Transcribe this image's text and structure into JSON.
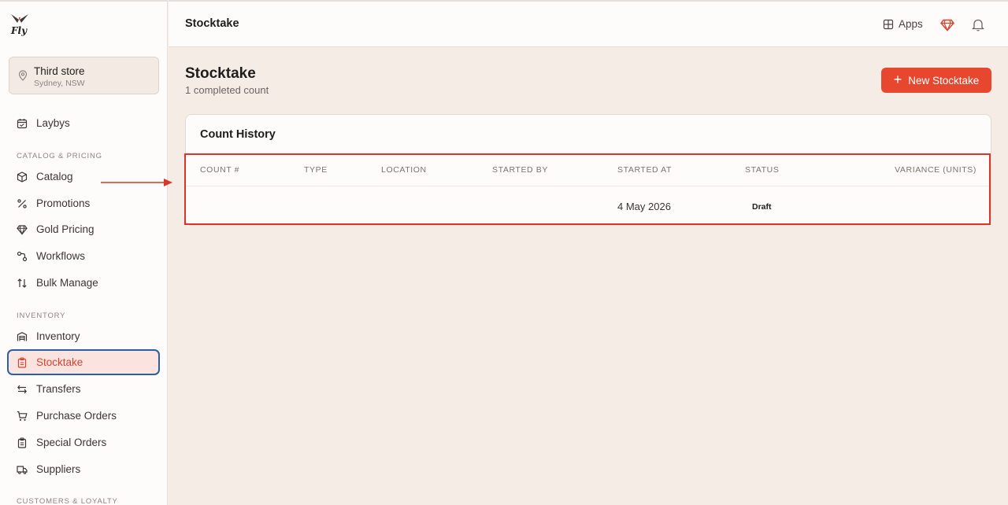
{
  "brand": {
    "logo_text": "Fly"
  },
  "store": {
    "name": "Third store",
    "location": "Sydney, NSW",
    "icon": "map-pin-icon"
  },
  "sidebar": {
    "items_top": [
      {
        "label": "Laybys",
        "icon": "calendar-icon"
      }
    ],
    "sections": [
      {
        "label": "CATALOG & PRICING",
        "items": [
          {
            "label": "Catalog",
            "icon": "box-icon"
          },
          {
            "label": "Promotions",
            "icon": "percent-icon"
          },
          {
            "label": "Gold Pricing",
            "icon": "gem-icon"
          },
          {
            "label": "Workflows",
            "icon": "workflow-icon"
          },
          {
            "label": "Bulk Manage",
            "icon": "arrows-up-down-icon"
          }
        ]
      },
      {
        "label": "INVENTORY",
        "items": [
          {
            "label": "Inventory",
            "icon": "warehouse-icon"
          },
          {
            "label": "Stocktake",
            "icon": "clipboard-icon",
            "active": true
          },
          {
            "label": "Transfers",
            "icon": "transfer-icon"
          },
          {
            "label": "Purchase Orders",
            "icon": "cart-icon"
          },
          {
            "label": "Special Orders",
            "icon": "clipboard-list-icon"
          },
          {
            "label": "Suppliers",
            "icon": "truck-icon"
          }
        ]
      },
      {
        "label": "CUSTOMERS & LOYALTY",
        "items": []
      }
    ]
  },
  "topbar": {
    "title": "Stocktake",
    "apps_label": "Apps"
  },
  "page": {
    "title": "Stocktake",
    "subtitle": "1 completed count",
    "new_button_label": "New Stocktake"
  },
  "history": {
    "title": "Count History",
    "columns": [
      "COUNT #",
      "TYPE",
      "LOCATION",
      "STARTED BY",
      "STARTED AT",
      "STATUS",
      "VARIANCE (UNITS)"
    ],
    "rows": [
      {
        "count": "",
        "type": "",
        "location": "",
        "started_by": "",
        "started_at": "4 May 2026",
        "status": "Draft",
        "variance": ""
      }
    ]
  },
  "colors": {
    "accent": "#e8472f",
    "active_bg": "#fbe4df",
    "active_border": "#2d5fa6",
    "highlight": "#d9352a",
    "background": "#f5ede5"
  }
}
